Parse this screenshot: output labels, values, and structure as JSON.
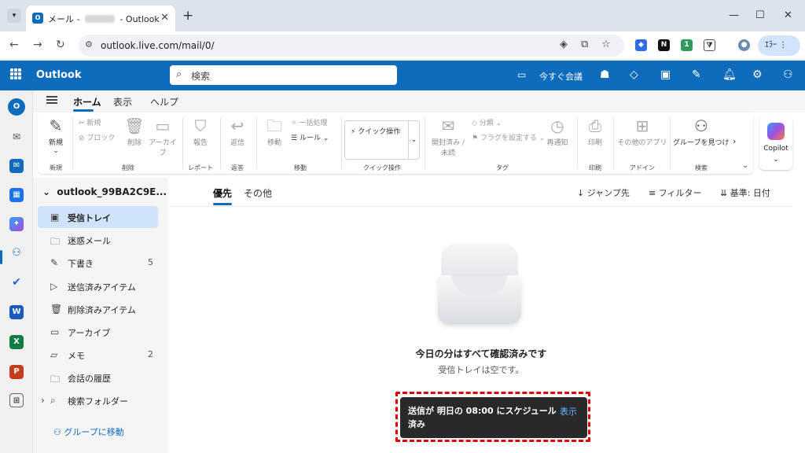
{
  "browser": {
    "tab_title_left": "メール - ",
    "tab_title_right": " - Outlook",
    "url": "outlook.live.com/mail/0/",
    "profile_label": "ｴﾗｰ"
  },
  "header": {
    "brand": "Outlook",
    "search_placeholder": "検索",
    "meet_now": "今すぐ会議"
  },
  "ribbon_tabs": [
    "ホーム",
    "表示",
    "ヘルプ"
  ],
  "ribbon": {
    "new": "新規",
    "new_group": "新規",
    "report_phish": "報告",
    "reply_all": "返信",
    "move": "移動",
    "sweep": "一括処理",
    "rules": "ルール",
    "read_unread": "開封済み / 未読",
    "categorize": "分類",
    "flag": "フラグを設定する",
    "snooze": "再通知",
    "print": "印刷",
    "other_apps": "その他のアプリ",
    "find_groups": "グループを見つける",
    "quick_steps": "クイック操作",
    "new_mail_small": "新規",
    "block_small": "ブロック",
    "delete": "削除",
    "archive": "アーカイブ",
    "groups": {
      "new": "新規",
      "delete": "削除",
      "report": "レポート",
      "respond": "返答",
      "move": "移動",
      "quick": "クイック操作",
      "tags": "タグ",
      "print": "印刷",
      "addins": "アドイン",
      "search": "検索"
    },
    "copilot": "Copilot"
  },
  "folder_pane": {
    "account": "outlook_99BA2C9E...",
    "folders": [
      {
        "label": "受信トレイ",
        "count": ""
      },
      {
        "label": "迷惑メール",
        "count": ""
      },
      {
        "label": "下書き",
        "count": "5"
      },
      {
        "label": "送信済みアイテム",
        "count": ""
      },
      {
        "label": "削除済みアイテム",
        "count": ""
      },
      {
        "label": "アーカイブ",
        "count": ""
      },
      {
        "label": "メモ",
        "count": "2"
      },
      {
        "label": "会話の履歴",
        "count": ""
      },
      {
        "label": "検索フォルダー",
        "count": ""
      }
    ],
    "goto_groups": "グループに移動"
  },
  "mail_list": {
    "tab_focused": "優先",
    "tab_other": "その他",
    "jump": "ジャンプ先",
    "filter": "フィルター",
    "sort": "基準: 日付",
    "empty_title": "今日の分はすべて確認済みです",
    "empty_sub": "受信トレイは空です。"
  },
  "toast": {
    "message": "送信が 明日の 08:00 にスケジュール済み",
    "action": "表示"
  },
  "colors": {
    "brand": "#0f6cbd",
    "toast_bg": "#292929",
    "highlight": "#e10000"
  }
}
